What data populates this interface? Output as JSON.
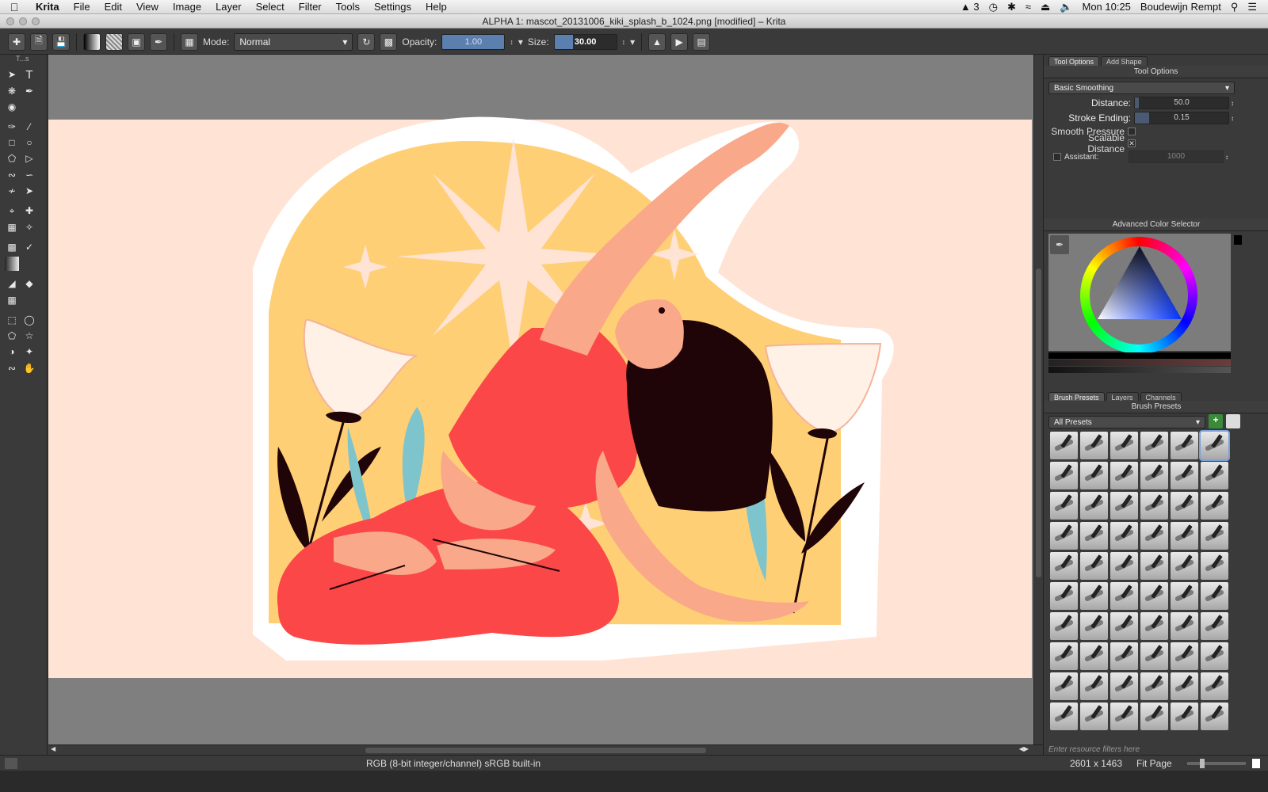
{
  "menubar": {
    "apple_icon": "apple-logo",
    "app_name": "Krita",
    "items": [
      "File",
      "Edit",
      "View",
      "Image",
      "Layer",
      "Select",
      "Filter",
      "Tools",
      "Settings",
      "Help"
    ],
    "status": {
      "adobe_count": "3",
      "time": "Mon 10:25",
      "user": "Boudewijn Rempt"
    }
  },
  "window": {
    "title": "ALPHA 1: mascot_20131006_kiki_splash_b_1024.png [modified] – Krita"
  },
  "toolbar": {
    "mode_label": "Mode:",
    "mode_value": "Normal",
    "opacity_label": "Opacity:",
    "opacity_value": "1.00",
    "opacity_level": 1.0,
    "size_label": "Size:",
    "size_value": "30.00",
    "size_level": 0.3
  },
  "toolbox": {
    "header": "T...s"
  },
  "tool_options": {
    "tabs": [
      "Tool Options",
      "Add Shape"
    ],
    "title": "Tool Options",
    "smoothing": "Basic Smoothing",
    "distance_label": "Distance:",
    "distance_value": "50.0",
    "stroke_ending_label": "Stroke Ending:",
    "stroke_ending_value": "0.15",
    "smooth_pressure_label": "Smooth Pressure",
    "scalable_distance_label": "Scalable Distance",
    "assistant_label": "Assistant:",
    "assistant_value": "1000"
  },
  "color_selector": {
    "title": "Advanced Color Selector"
  },
  "bottom_tabs": [
    "Brush Presets",
    "Layers",
    "Channels"
  ],
  "brush_presets": {
    "title": "Brush Presets",
    "filter_value": "All Presets",
    "search_placeholder": "Enter resource filters here",
    "count": 60
  },
  "statusbar": {
    "color_info": "RGB (8-bit integer/channel)  sRGB built-in",
    "dimensions": "2601 x 1463",
    "zoom_label": "Fit Page"
  },
  "colors": {
    "canvas_bg": "#ffe3d4",
    "arch": "#ffcf75",
    "shirt": "#fb4747",
    "skin": "#f9a88a",
    "hair": "#1f0408",
    "leaf_blue": "#7ec4cd"
  }
}
